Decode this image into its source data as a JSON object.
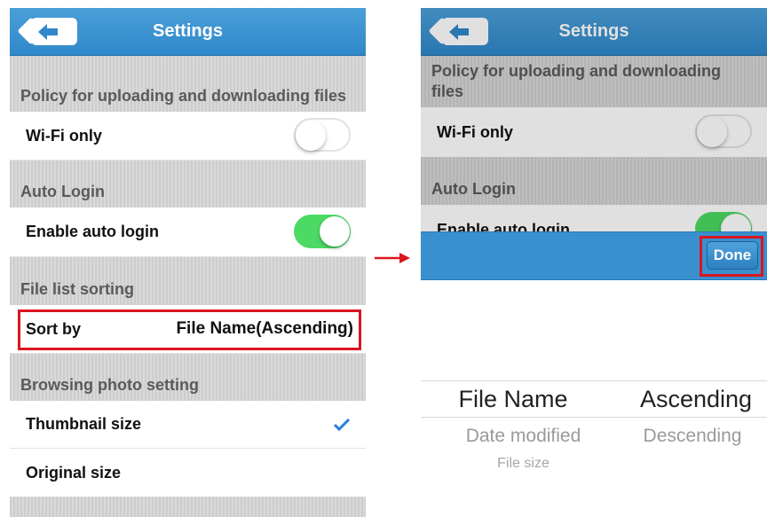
{
  "left": {
    "nav_title": "Settings",
    "sections": {
      "policy": "Policy for uploading and downloading files",
      "auto_login": "Auto Login",
      "sorting": "File list sorting",
      "photo": "Browsing photo setting"
    },
    "rows": {
      "wifi_only": "Wi-Fi only",
      "enable_auto_login": "Enable auto login",
      "sort_by": "Sort by",
      "sort_value": "File Name(Ascending)",
      "thumbnail": "Thumbnail size",
      "original": "Original size"
    },
    "states": {
      "wifi_only": false,
      "enable_auto_login": true,
      "thumbnail_selected": true
    }
  },
  "right": {
    "nav_title": "Settings",
    "sections": {
      "policy": "Policy for uploading and downloading files",
      "auto_login": "Auto Login"
    },
    "rows": {
      "wifi_only": "Wi-Fi only",
      "enable_auto_login": "Enable auto login"
    },
    "done_label": "Done",
    "picker": {
      "column1": [
        "File Name",
        "Date modified",
        "File size"
      ],
      "column2": [
        "Ascending",
        "Descending"
      ]
    }
  },
  "colors": {
    "nav_blue": "#3a8fcf",
    "toggle_on": "#4cd964",
    "highlight_red": "#d9161f",
    "checkmark": "#2b7de0"
  }
}
